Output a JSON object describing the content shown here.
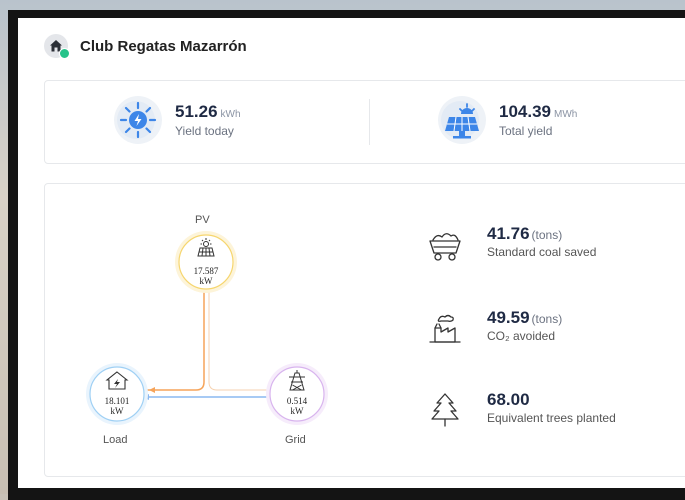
{
  "station": {
    "name": "Club Regatas Mazarrón"
  },
  "yield": {
    "today": {
      "value": "51.26",
      "unit": "kWh",
      "label": "Yield today"
    },
    "total": {
      "value": "104.39",
      "unit": "MWh",
      "label": "Total yield"
    }
  },
  "flow": {
    "pv": {
      "label": "PV",
      "value": "17.587",
      "unit": "kW"
    },
    "load": {
      "label": "Load",
      "value": "18.101",
      "unit": "kW"
    },
    "grid": {
      "label": "Grid",
      "value": "0.514",
      "unit": "kW"
    }
  },
  "environment": {
    "coal": {
      "value": "41.76",
      "unit": "(tons)",
      "label": "Standard coal saved"
    },
    "co2": {
      "value": "49.59",
      "unit": "(tons)",
      "label": "CO₂ avoided"
    },
    "trees": {
      "value": "68.00",
      "label": "Equivalent trees planted"
    }
  },
  "colors": {
    "pv_line": "#f6a45a",
    "grid_line": "#8ab8f0",
    "status_online": "#27c38a",
    "pv_ring": "#fbe7a4",
    "load_ring": "#b9dcf7",
    "grid_ring": "#e3c9f2"
  }
}
